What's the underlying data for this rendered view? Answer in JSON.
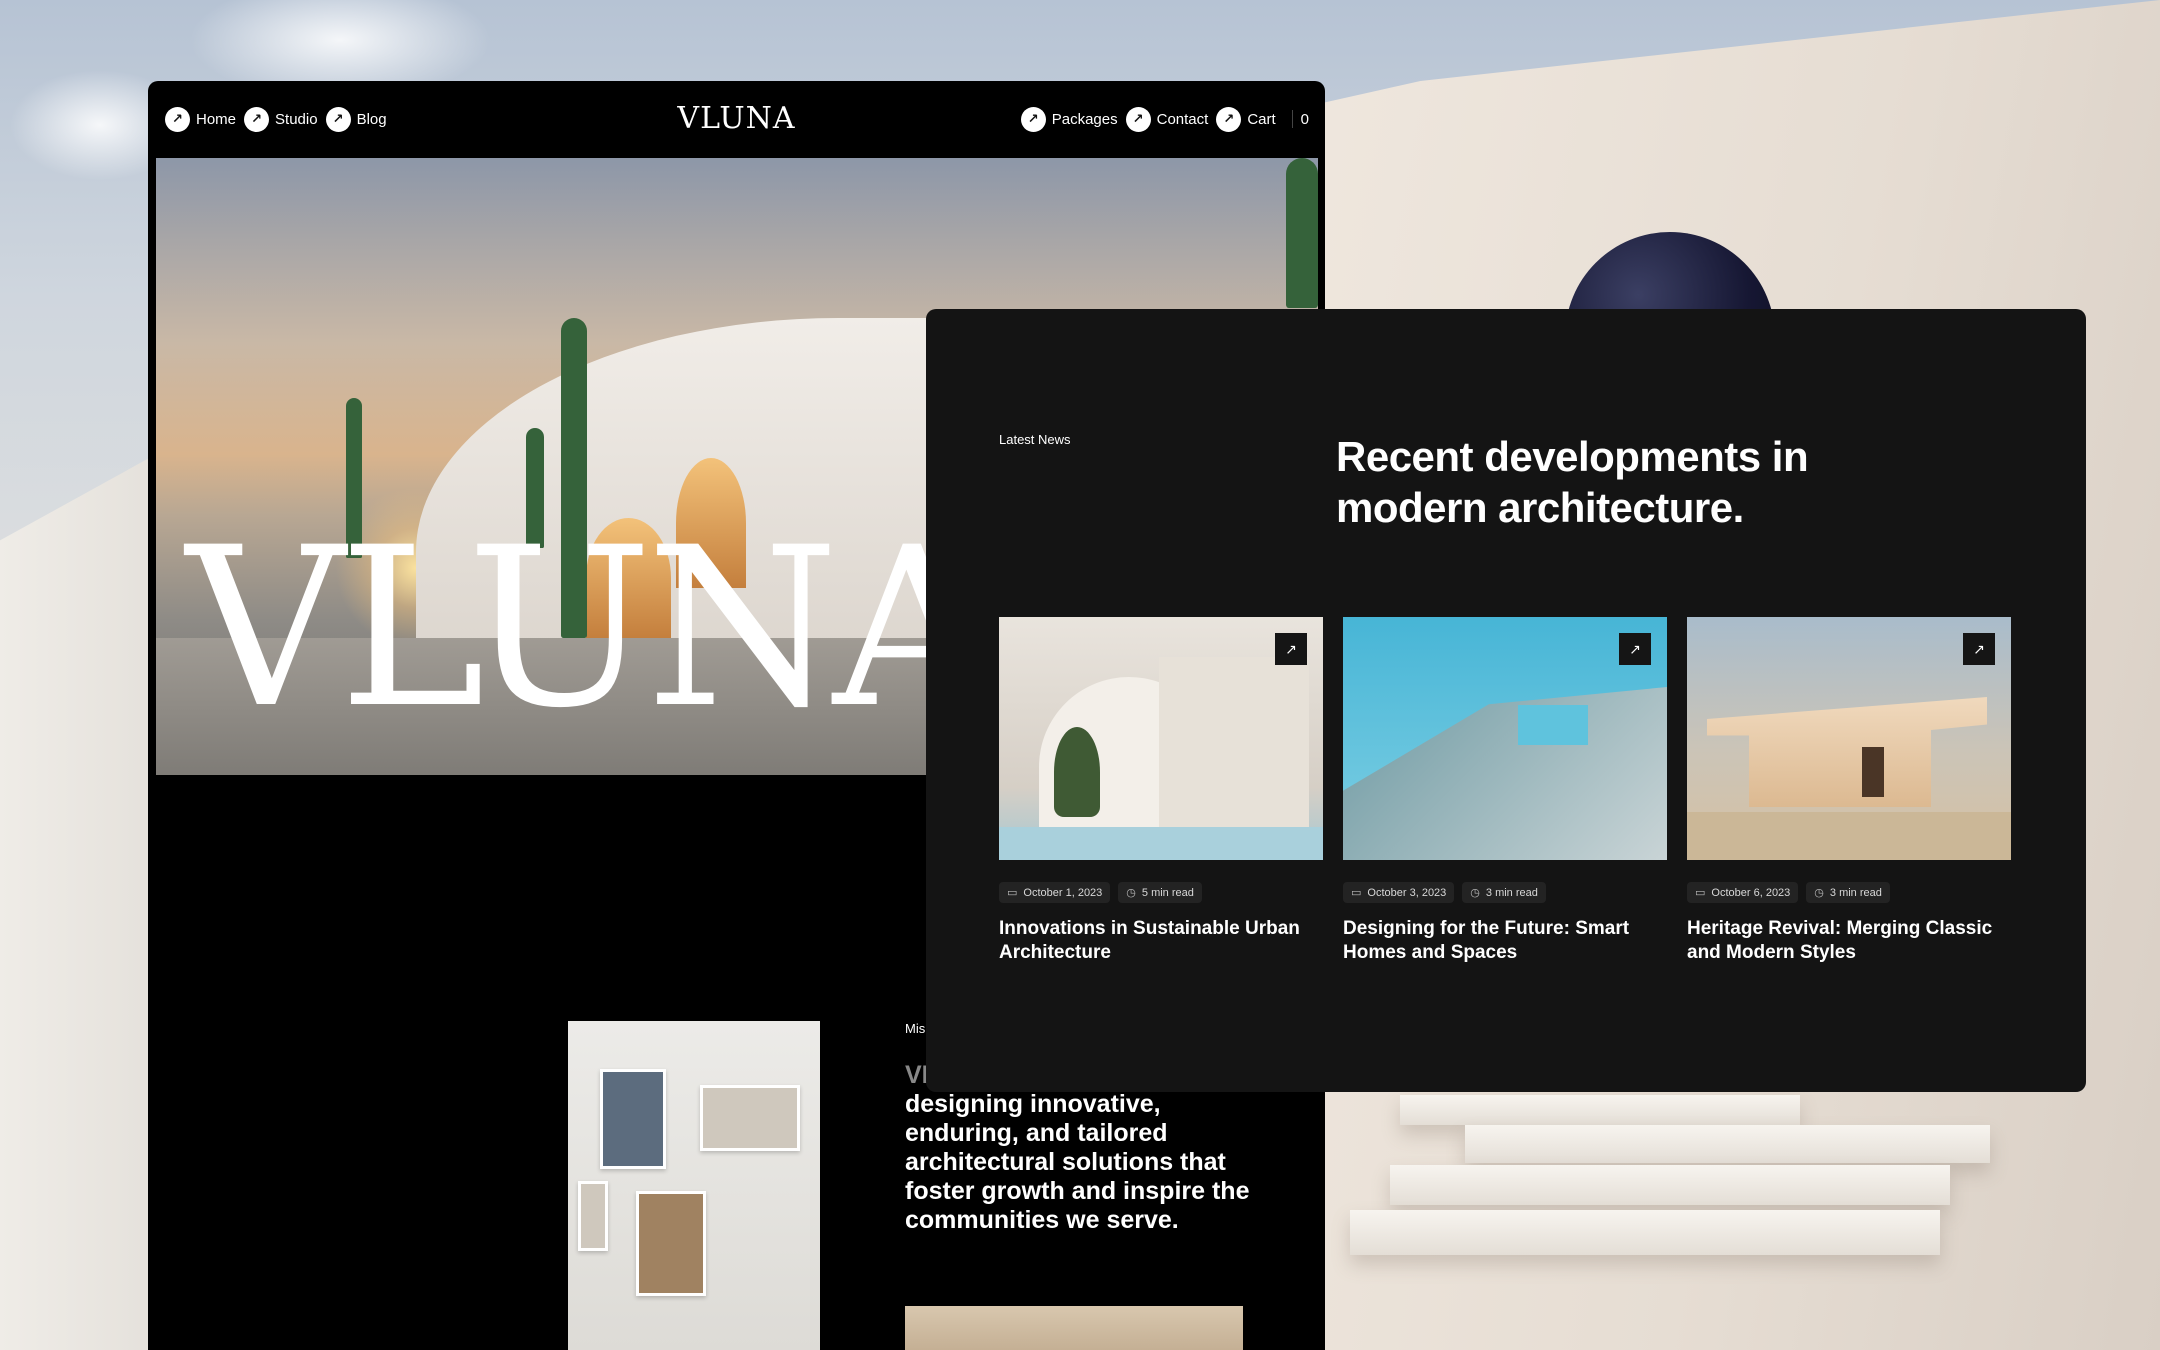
{
  "site": {
    "brand": "VLUNA",
    "hero_word": "VLUNA",
    "nav_left": [
      {
        "label": "Home",
        "icon": "arrow-up-right-icon"
      },
      {
        "label": "Studio",
        "icon": "arrow-up-right-icon"
      },
      {
        "label": "Blog",
        "icon": "arrow-up-right-icon"
      }
    ],
    "nav_right": [
      {
        "label": "Packages",
        "icon": "arrow-up-right-icon"
      },
      {
        "label": "Contact",
        "icon": "arrow-up-right-icon"
      },
      {
        "label": "Cart",
        "icon": "arrow-up-right-icon"
      }
    ],
    "cart_count": "0",
    "mission_eyebrow": "Mis",
    "mission_text_visible": "designing innovative, enduring, and tailored architectural solutions that foster growth and inspire the communities we serve.",
    "mission_text_partial": "VI"
  },
  "news": {
    "eyebrow": "Latest News",
    "title": "Recent developments in modern architecture.",
    "cards": [
      {
        "date": "October 1, 2023",
        "read": "5 min read",
        "title": "Innovations in Sustainable Urban Architecture"
      },
      {
        "date": "October 3, 2023",
        "read": "3 min read",
        "title": "Designing for the Future: Smart Homes and Spaces"
      },
      {
        "date": "October 6, 2023",
        "read": "3 min read",
        "title": "Heritage Revival: Merging Classic and Modern Styles"
      }
    ]
  },
  "icons": {
    "arrow": "↗",
    "calendar": "▭",
    "clock": "◷"
  },
  "colors": {
    "site_bg": "#000000",
    "panel_bg": "#141414",
    "text": "#ffffff"
  }
}
